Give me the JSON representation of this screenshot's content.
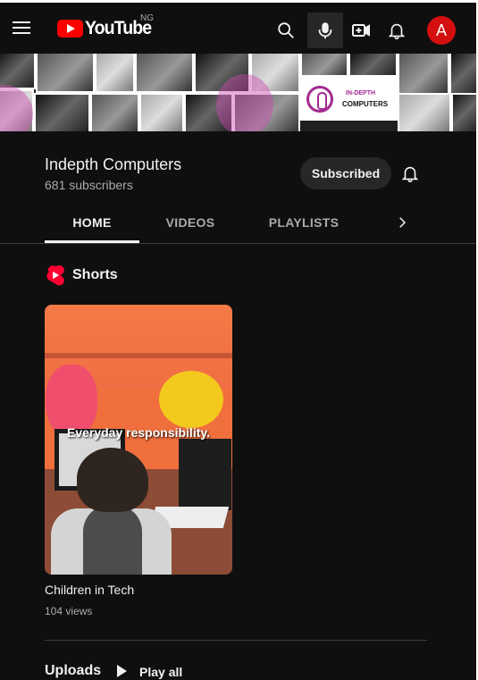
{
  "header": {
    "logo_text": "YouTube",
    "country_code": "NG",
    "avatar_initial": "A",
    "icons": [
      "menu-icon",
      "youtube-logo-icon",
      "search-icon",
      "microphone-icon",
      "create-video-icon",
      "notifications-icon"
    ]
  },
  "banner": {
    "brand_line_1": "IN-DEPTH",
    "brand_line_2": "COMPUTERS",
    "accent_color": "#a32a91"
  },
  "channel": {
    "name": "Indepth Computers",
    "subscribers": "681 subscribers",
    "subscribed_label": "Subscribed"
  },
  "tabs": [
    {
      "label": "HOME",
      "active": true
    },
    {
      "label": "VIDEOS",
      "active": false
    },
    {
      "label": "PLAYLISTS",
      "active": false
    }
  ],
  "shorts": {
    "section_title": "Shorts",
    "items": [
      {
        "caption": "Everyday responsibility.",
        "title": "Children in Tech",
        "views": "104 views"
      }
    ]
  },
  "uploads": {
    "section_title": "Uploads",
    "play_all_label": "Play all"
  },
  "colors": {
    "background": "#0f0f0f",
    "brand_red": "#ff0000",
    "avatar_red": "#d40f0f",
    "button_gray": "#272727"
  }
}
